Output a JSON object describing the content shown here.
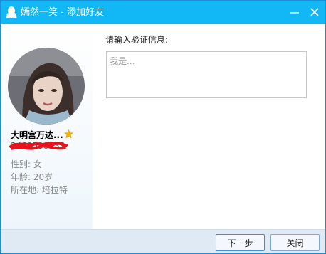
{
  "window": {
    "title": "嫣然一笑 - 添加好友",
    "logo_icon": "qq-penguin-icon",
    "minimize_icon": "minimize-icon",
    "close_icon": "close-icon"
  },
  "profile": {
    "avatar_icon": "user-avatar-photo",
    "nickname": "大明宫万达...",
    "star_icon": "star-icon",
    "qq_number": "2460530531",
    "gender": "性别: 女",
    "age": "年龄: 20岁",
    "location": "所在地:  培拉特"
  },
  "verify": {
    "label": "请输入验证信息:",
    "value": "",
    "placeholder": "我是..."
  },
  "footer": {
    "next_label": "下一步",
    "cancel_label": "关闭"
  },
  "colors": {
    "titlebar": "#12b7f5",
    "footer": "#dfeaf5",
    "scribble": "#e8121d",
    "star": "#f5b400"
  }
}
